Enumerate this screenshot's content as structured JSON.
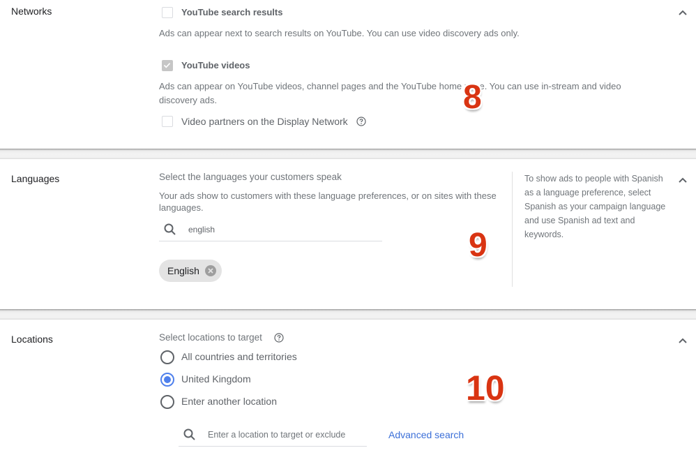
{
  "networks": {
    "title": "Networks",
    "options": [
      {
        "label": "YouTube search results",
        "checked": false,
        "description": "Ads can appear next to search results on YouTube. You can use video discovery ads only."
      },
      {
        "label": "YouTube videos",
        "checked": true,
        "description": "Ads can appear on YouTube videos, channel pages and the YouTube home page. You can use in-stream and video discovery ads."
      },
      {
        "label": "Video partners on the Display Network",
        "checked": false
      }
    ],
    "help_icon": "help-circle-icon",
    "collapse_icon": "chevron-up-icon"
  },
  "languages": {
    "title": "Languages",
    "prompt": "Select the languages your customers speak",
    "description": "Your ads show to customers with these language preferences, or on sites with these languages.",
    "search_value": "english",
    "search_icon": "search-icon",
    "chips": [
      {
        "label": "English",
        "remove_icon": "close-circle-icon"
      }
    ],
    "side_note": "To show ads to people with Spanish as a language preference, select Spanish as your campaign language and use Spanish ad text and keywords.",
    "collapse_icon": "chevron-up-icon"
  },
  "locations": {
    "title": "Locations",
    "prompt": "Select locations to target",
    "options": [
      {
        "label": "All countries and territories",
        "selected": false
      },
      {
        "label": "United Kingdom",
        "selected": true
      },
      {
        "label": "Enter another location",
        "selected": false
      }
    ],
    "search_placeholder": "Enter a location to target or exclude",
    "advanced_search_label": "Advanced search",
    "collapse_icon": "chevron-up-icon"
  },
  "annotations": {
    "badge_8": "8",
    "badge_9": "9",
    "badge_10": "10"
  },
  "colors": {
    "accent_blue": "#4f80ec",
    "link_blue": "#3b6fd8",
    "badge_red": "#d93412"
  }
}
